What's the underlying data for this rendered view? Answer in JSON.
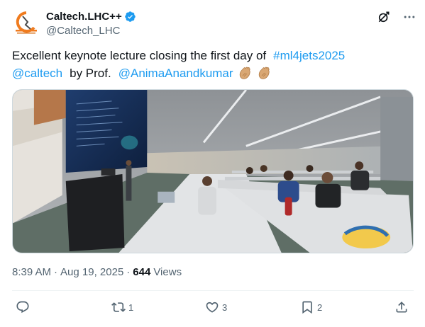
{
  "author": {
    "display_name": "Caltech.LHC++",
    "handle": "@Caltech_LHC",
    "verified": true,
    "avatar_icon": "caltech-lhc-logo",
    "avatar_caption": "CALTECH CHAPTER LHC++"
  },
  "header_icons": [
    "grok-icon",
    "more-icon"
  ],
  "tweet": {
    "line1_text": "Excellent keynote lecture closing the first day of",
    "hashtag": "#ml4jets2025",
    "mention1": "@caltech",
    "line2_text": "by Prof.",
    "mention2": "@AnimaAnandkumar",
    "emojis": [
      "clapping-hands-icon",
      "clapping-hands-icon"
    ]
  },
  "photo": {
    "description_icon": "lecture-hall-photo"
  },
  "meta": {
    "time": "8:39 AM",
    "separator": "·",
    "date": "Aug 19, 2025",
    "views_count": "644",
    "views_label": "Views"
  },
  "actions": {
    "reply_count": "",
    "repost_count": "1",
    "like_count": "3",
    "bookmark_count": "2"
  },
  "colors": {
    "link": "#1d9bf0",
    "secondary_text": "#536471",
    "primary_text": "#0f1419",
    "verified": "#1d9bf0"
  }
}
